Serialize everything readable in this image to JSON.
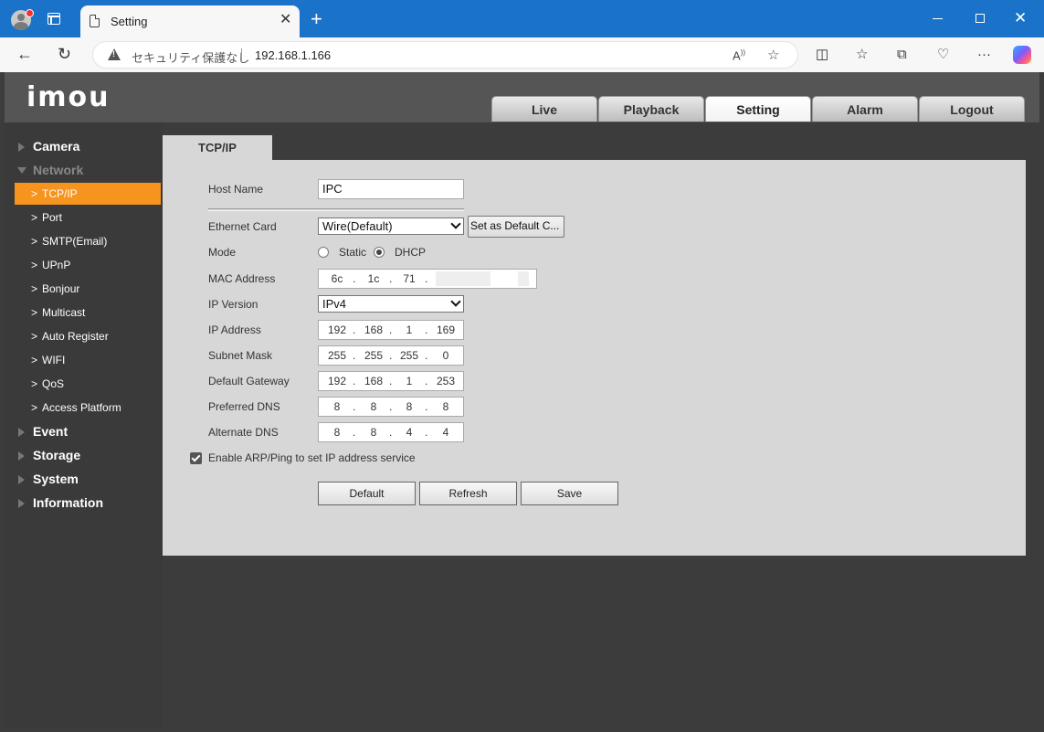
{
  "browser": {
    "tab_title": "Setting",
    "security_label": "セキュリティ保護なし",
    "url": "192.168.1.166"
  },
  "app": {
    "logo": "imou",
    "nav": [
      "Live",
      "Playback",
      "Setting",
      "Alarm",
      "Logout"
    ],
    "active_nav": "Setting"
  },
  "sidebar": {
    "categories_top": [
      {
        "label": "Camera",
        "open": false
      },
      {
        "label": "Network",
        "open": true
      }
    ],
    "network_items": [
      "TCP/IP",
      "Port",
      "SMTP(Email)",
      "UPnP",
      "Bonjour",
      "Multicast",
      "Auto Register",
      "WIFI",
      "QoS",
      "Access Platform"
    ],
    "active_item": "TCP/IP",
    "categories_bottom": [
      "Event",
      "Storage",
      "System",
      "Information"
    ]
  },
  "content": {
    "tab": "TCP/IP",
    "host_name_label": "Host Name",
    "host_name": "IPC",
    "ethernet_card_label": "Ethernet Card",
    "ethernet_card": "Wire(Default)",
    "set_default_button": "Set as Default C...",
    "mode_label": "Mode",
    "mode_options": [
      "Static",
      "DHCP"
    ],
    "mode_selected": "DHCP",
    "mac_label": "MAC Address",
    "mac": [
      "6c",
      "1c",
      "71"
    ],
    "ip_version_label": "IP Version",
    "ip_version": "IPv4",
    "ip_address_label": "IP Address",
    "ip_address": [
      "192",
      "168",
      "1",
      "169"
    ],
    "subnet_mask_label": "Subnet Mask",
    "subnet_mask": [
      "255",
      "255",
      "255",
      "0"
    ],
    "gateway_label": "Default Gateway",
    "gateway": [
      "192",
      "168",
      "1",
      "253"
    ],
    "preferred_dns_label": "Preferred DNS",
    "preferred_dns": [
      "8",
      "8",
      "8",
      "8"
    ],
    "alternate_dns_label": "Alternate DNS",
    "alternate_dns": [
      "8",
      "8",
      "4",
      "4"
    ],
    "arp_label": "Enable ARP/Ping to set IP address service",
    "arp_checked": true,
    "buttons": {
      "default": "Default",
      "refresh": "Refresh",
      "save": "Save"
    }
  }
}
